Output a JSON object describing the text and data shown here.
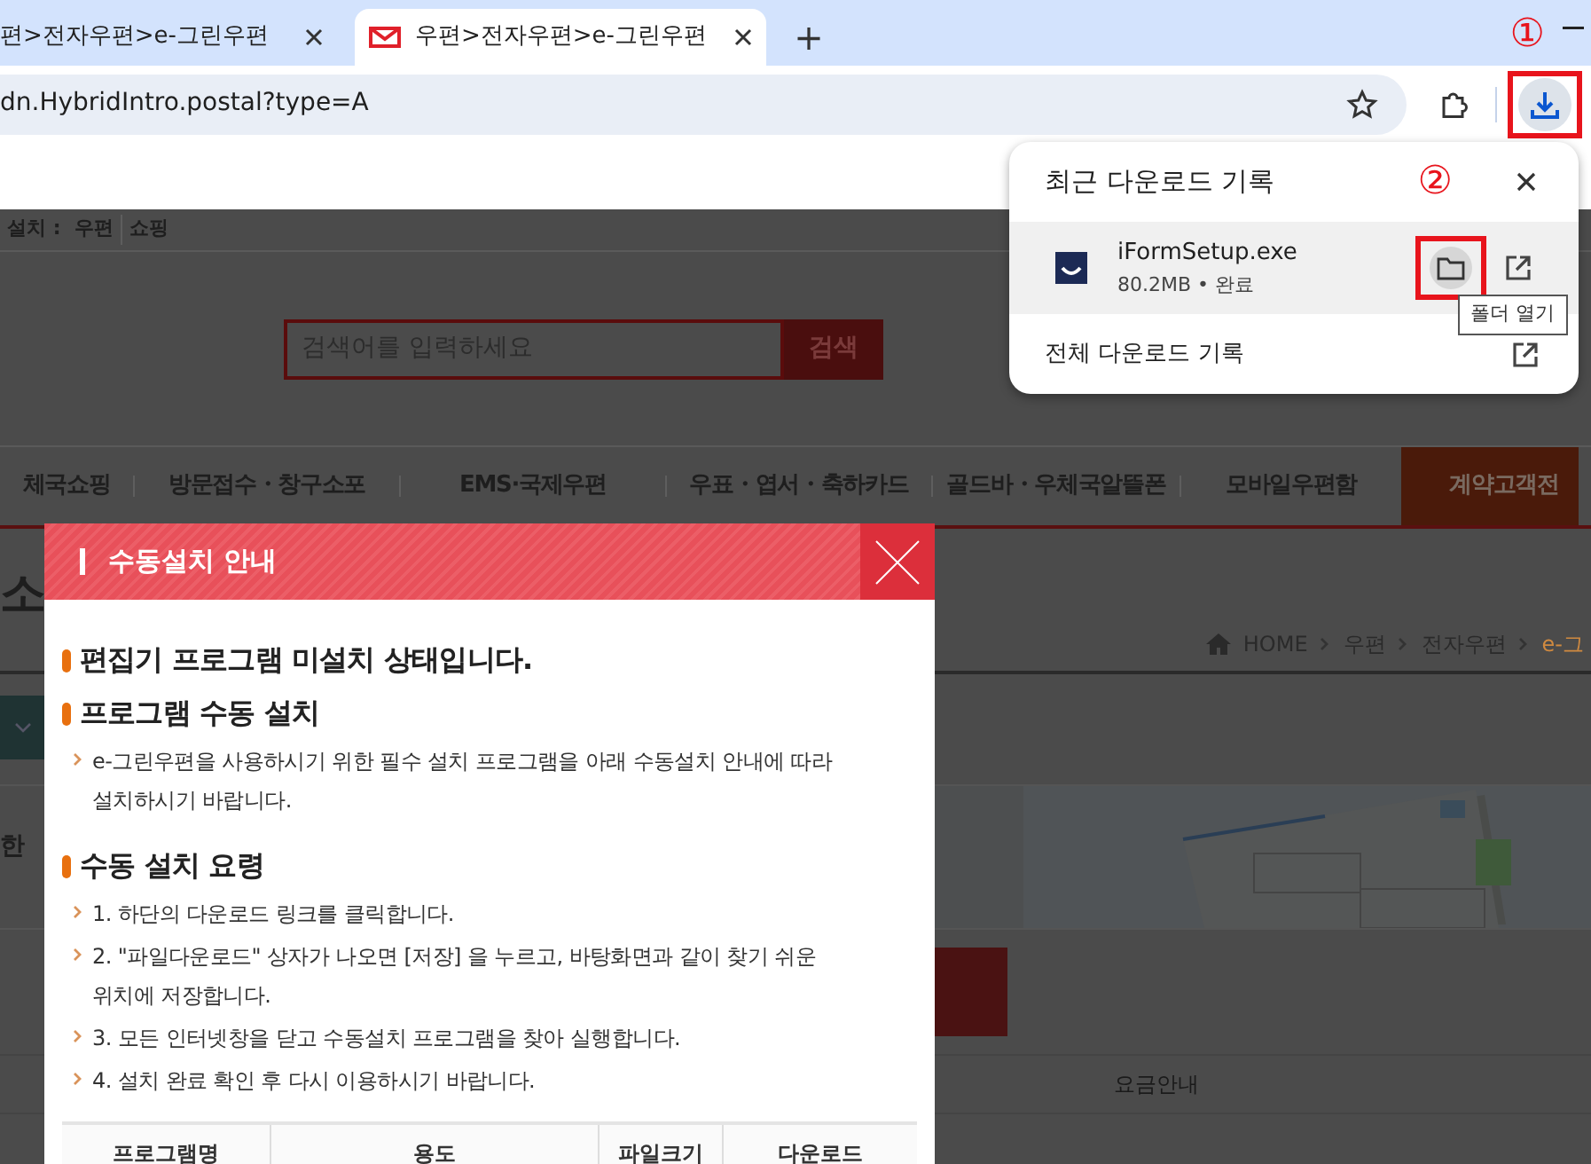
{
  "tabs": [
    {
      "title": "편>전자우편>e-그린우편",
      "selected": false
    },
    {
      "title": "우편>전자우편>e-그린우편",
      "selected": true
    }
  ],
  "new_tab": "+",
  "address_bar": {
    "url": "dn.HybridIntro.postal?type=A"
  },
  "download_button": {
    "outlined": true,
    "annotation": "①"
  },
  "downloads_panel": {
    "title": "최근 다운로드 기록",
    "annotation": "②",
    "items": [
      {
        "file_name": "iFormSetup.exe",
        "details": "80.2MB • 완료",
        "folder_outlined": true
      }
    ],
    "tooltip": "폴더 열기",
    "footer_link": "전체 다운로드 기록"
  },
  "page": {
    "top_label": "설치 :",
    "top_links": [
      "우편",
      "쇼핑"
    ],
    "search": {
      "placeholder": "검색어를 입력하세요",
      "button": "검색"
    },
    "nav": [
      {
        "label": "체국쇼핑",
        "highlighted": false
      },
      {
        "label": "방문접수・창구소포",
        "highlighted": false
      },
      {
        "label": "EMS·국제우편",
        "highlighted": false
      },
      {
        "label": "우표・엽서・축하카드",
        "highlighted": false
      },
      {
        "label": "골드바・우체국알뜰폰",
        "highlighted": false
      },
      {
        "label": "모바일우편함",
        "highlighted": false
      },
      {
        "label": "계약고객전",
        "highlighted": true
      }
    ],
    "page_title": "소",
    "breadcrumb": [
      "HOME",
      "우편",
      "전자우편",
      "e-그"
    ],
    "section_text": "한",
    "tab_label": "요금안내"
  },
  "modal": {
    "title": "수동설치 안내",
    "sections": [
      {
        "heading": "편집기 프로그램 미설치 상태입니다."
      },
      {
        "heading": "프로그램 수동 설치",
        "items": [
          "e-그린우편을 사용하시기 위한 필수 설치 프로그램을 아래 수동설치 안내에 따라 설치하시기 바랍니다."
        ]
      },
      {
        "heading": "수동 설치 요령",
        "items": [
          "1. 하단의 다운로드 링크를 클릭합니다.",
          "2. \"파일다운로드\" 상자가 나오면 [저장] 을 누르고, 바탕화면과 같이 찾기 쉬운 위치에 저장합니다.",
          "3. 모든 인터넷창을 닫고 수동설치 프로그램을 찾아 실행합니다.",
          "4. 설치 완료 확인 후 다시 이용하시기 바랍니다."
        ]
      }
    ],
    "table": {
      "columns": [
        "프로그램명",
        "용도",
        "파일크기",
        "다운로드"
      ]
    }
  }
}
